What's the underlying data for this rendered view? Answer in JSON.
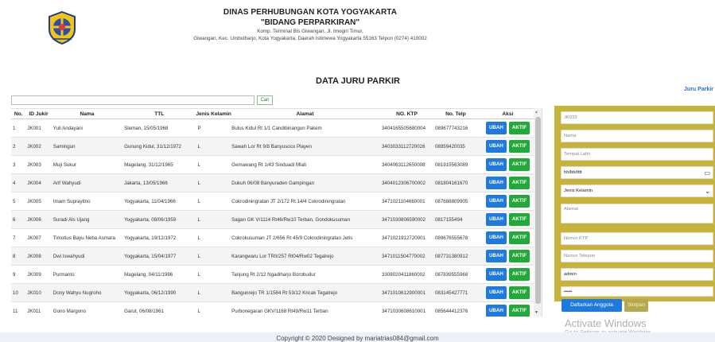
{
  "header": {
    "org": "DINAS PERHUBUNGAN KOTA YOGYAKARTA",
    "division": "\"BIDANG PERPARKIRAN\"",
    "address_1": "Komp. Terminal Bis Giwangan, Jl. Imogiri Timur,",
    "address_2": "Giwangan, Kec. Umbulharjo, Kota Yogyakarta, Daerah Istimewa Yogyakarta 55163 Telpon (0274) 410002"
  },
  "nav": {
    "link": "Juru Parkir"
  },
  "page_title": "DATA JURU PARKIR",
  "search": {
    "value": "",
    "button": "Cari"
  },
  "table": {
    "headers": [
      "No.",
      "ID Jukir",
      "Nama",
      "TTL",
      "Jenis Kelamin",
      "Alamat",
      "NO. KTP",
      "No. Telp",
      "Aksi"
    ],
    "rows": [
      {
        "no": "1",
        "id": "JK001",
        "nama": "Yuli Andayani",
        "ttl": "Sleman, 15/05/1968",
        "jk": "P",
        "alamat": "Bulus Kidul Rt 1/1 Candibinangun Pakem",
        "ktp": "3404165505680004",
        "telp": "089677743216"
      },
      {
        "no": "2",
        "id": "JK002",
        "nama": "Samingun",
        "ttl": "Gunung Kidul, 31/12/1972",
        "jk": "L",
        "alamat": "Sawah Lor Rt 9/8 Banyusoco Playen",
        "ktp": "3403033112720026",
        "telp": "08959420035"
      },
      {
        "no": "3",
        "id": "JK003",
        "nama": "Muji Sukur",
        "ttl": "Magelang, 31/12/1965",
        "jk": "L",
        "alamat": "Gemawang Rt 1/43 Sinduadi Mlati",
        "ktp": "3404063112650008",
        "telp": "081915563089"
      },
      {
        "no": "4",
        "id": "JK004",
        "nama": "Arif Wahyudi",
        "ttl": "Jakarta, 13/05/1966",
        "jk": "L",
        "alamat": "Dukuh 06/08 Banyuraden Gampingan",
        "ktp": "3404012306700002",
        "telp": "081804161670"
      },
      {
        "no": "5",
        "id": "JK005",
        "nama": "Imam Suprayitno",
        "ttl": "Yogyakarta, 11/04/1966",
        "jk": "L",
        "alamat": "Cokrodiningratan JT 2/172 Rt 14/4 Cokrodiningratan",
        "ktp": "3471021104660001",
        "telp": "087688809905"
      },
      {
        "no": "6",
        "id": "JK006",
        "nama": "Suradi Als Ujang",
        "ttl": "Yogyakarta, 08/06/1959",
        "jk": "L",
        "alamat": "Sagan GK V/1114 Rt46/Rw10 Terban, Gondokusuman",
        "ktp": "3471030806590002",
        "telp": "0817155494"
      },
      {
        "no": "7",
        "id": "JK007",
        "nama": "Timotius Bayu Neba Asmara",
        "ttl": "Yogyakarta, 19/12/1972",
        "jk": "L",
        "alamat": "Cokrokusuman JT 2/656 Rt 45/9 Cokrodiningratan Jetis",
        "ktp": "3471021912720001",
        "telp": "089676555678"
      },
      {
        "no": "8",
        "id": "JK008",
        "nama": "Dwi Iswahyudi",
        "ttl": "Yogyakarta, 15/04/1977",
        "jk": "L",
        "alamat": "Karangwaru Lor TRII/257 Rt04/Rw02 Tegalrejo",
        "ktp": "3471011504770002",
        "telp": "087731380912"
      },
      {
        "no": "9",
        "id": "JK009",
        "nama": "Purmanto",
        "ttl": "Magelang, 04/11/1986",
        "jk": "L",
        "alamat": "Tanjung Rt 2/12 Ngadiharjo Borobudur",
        "ktp": "3308020411860002",
        "telp": "087839555968"
      },
      {
        "no": "10",
        "id": "JK010",
        "nama": "Dony Wahyu Nugroho",
        "ttl": "Yogyakarta, 06/12/1990",
        "jk": "L",
        "alamat": "Bangunrejo TR 1/1584 Rt 53/12 Kricak Tegalrejo",
        "ktp": "3471010612900001",
        "telp": "083145427771"
      },
      {
        "no": "11",
        "id": "JK011",
        "nama": "Gono Margono",
        "ttl": "Garut, 06/08/1961",
        "jk": "L",
        "alamat": "Purbonegaran GKV/1168 Rt49/Rw11 Terban",
        "ktp": "3471030608610001",
        "telp": "085644412376"
      }
    ],
    "btn_ubah": "UBAH",
    "btn_aktif": "AKTIF"
  },
  "form": {
    "id_value": "JK033",
    "nama_placeholder": "Nama",
    "tempat_placeholder": "Tempat Lahir",
    "tanggal_placeholder": "hh/bb/tttt",
    "jk_selected": "Jenis Kelamin",
    "alamat_placeholder": "Alamat",
    "ktp_placeholder": "Nomor KTP",
    "telp_placeholder": "Nomor Telepon",
    "username_value": "admin",
    "password_value": "•••••",
    "btn_daftar": "Daftarkan Anggota",
    "btn_simpan": "Simpan"
  },
  "watermark": {
    "title": "Activate Windows",
    "subtitle": "Go to Settings to activate Windows."
  },
  "footer": "Copyright © 2020 Designed by mariatrias084@gmail.com",
  "colors": {
    "primary_blue": "#1f7ae0",
    "success_green": "#23a83a",
    "panel_gold": "#c6b33a"
  }
}
